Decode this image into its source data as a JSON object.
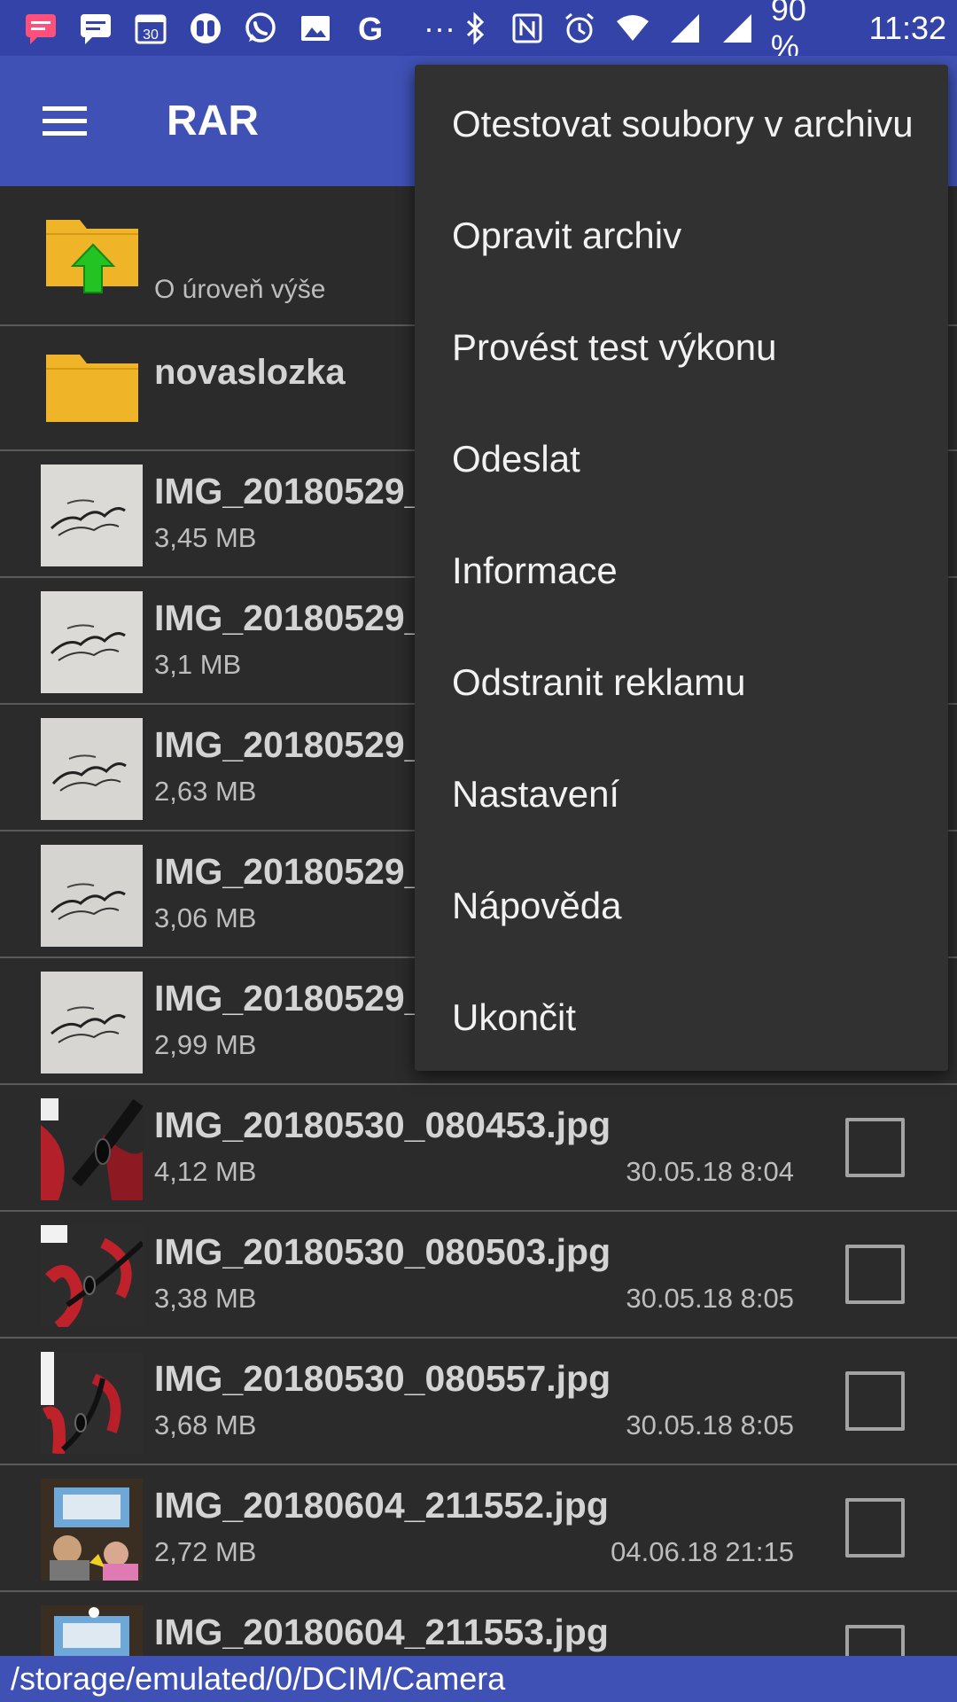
{
  "status_bar": {
    "battery": "90 %",
    "time": "11:32",
    "calendar_day": "30",
    "google_letter": "G",
    "more": "···",
    "left_icons": [
      "message-icon",
      "chat-icon",
      "calendar-icon",
      "binoculars-icon",
      "whatsapp-icon",
      "image-icon",
      "google-icon",
      "more-icon"
    ],
    "right_icons": [
      "bluetooth-icon",
      "nfc-icon",
      "alarm-icon",
      "wifi-icon",
      "signal-icon"
    ]
  },
  "app_bar": {
    "title": "RAR",
    "menu_icon": "hamburger-menu-icon"
  },
  "folders": [
    {
      "label": "O úroveň výše",
      "icon": "folder-up-icon"
    },
    {
      "label": "novaslozka",
      "icon": "folder-icon"
    }
  ],
  "files_under_menu": [
    {
      "name": "IMG_20180529_",
      "size": "3,45 MB"
    },
    {
      "name": "IMG_20180529_",
      "size": "3,1 MB"
    },
    {
      "name": "IMG_20180529_",
      "size": "2,63 MB"
    },
    {
      "name": "IMG_20180529_",
      "size": "3,06 MB"
    },
    {
      "name": "IMG_20180529_",
      "size": "2,99 MB"
    }
  ],
  "files": [
    {
      "name": "IMG_20180530_080453.jpg",
      "size": "4,12 MB",
      "date": "30.05.18 8:04",
      "checked": false
    },
    {
      "name": "IMG_20180530_080503.jpg",
      "size": "3,38 MB",
      "date": "30.05.18 8:05",
      "checked": false
    },
    {
      "name": "IMG_20180530_080557.jpg",
      "size": "3,68 MB",
      "date": "30.05.18 8:05",
      "checked": false
    },
    {
      "name": "IMG_20180604_211552.jpg",
      "size": "2,72 MB",
      "date": "04.06.18 21:15",
      "checked": false
    },
    {
      "name": "IMG_20180604_211553.jpg",
      "size": "",
      "date": "",
      "checked": false
    }
  ],
  "menu": {
    "items": [
      "Otestovat soubory v archivu",
      "Opravit archiv",
      "Provést test výkonu",
      "Odeslat",
      "Informace",
      "Odstranit reklamu",
      "Nastavení",
      "Nápověda",
      "Ukončit"
    ]
  },
  "path_bar": {
    "path": "/storage/emulated/0/DCIM/Camera"
  },
  "colors": {
    "status_bar": "#3343a8",
    "app_bar": "#3f51b5",
    "background": "#2b2b2b",
    "menu_background": "#313131",
    "folder": "#f0b429",
    "up_arrow": "#22c322"
  }
}
